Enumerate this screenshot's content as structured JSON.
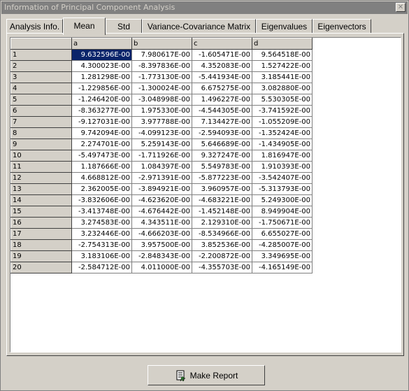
{
  "window": {
    "title": "Information of Principal Component Analysis",
    "close_glyph": "✕"
  },
  "tabs": [
    {
      "label": "Analysis Info.",
      "active": false
    },
    {
      "label": "Mean",
      "active": true
    },
    {
      "label": "Std",
      "active": false
    },
    {
      "label": "Variance-Covariance Matrix",
      "active": false
    },
    {
      "label": "Eigenvalues",
      "active": false
    },
    {
      "label": "Eigenvectors",
      "active": false
    }
  ],
  "grid": {
    "columns": [
      "a",
      "b",
      "c",
      "d"
    ],
    "rows": [
      {
        "label": "1",
        "values": [
          "9.632596E-00",
          "7.980617E-00",
          "-1.605471E-00",
          "9.564518E-00"
        ]
      },
      {
        "label": "2",
        "values": [
          "4.300023E-00",
          "-8.397836E-00",
          "4.352083E-00",
          "1.527422E-00"
        ]
      },
      {
        "label": "3",
        "values": [
          "1.281298E-00",
          "-1.773130E-00",
          "-5.441934E-00",
          "3.185441E-00"
        ]
      },
      {
        "label": "4",
        "values": [
          "-1.229856E-00",
          "-1.300024E-00",
          "6.675275E-00",
          "3.082880E-00"
        ]
      },
      {
        "label": "5",
        "values": [
          "-1.246420E-00",
          "-3.048998E-00",
          "1.496227E-00",
          "5.530305E-00"
        ]
      },
      {
        "label": "6",
        "values": [
          "-8.363277E-00",
          "1.975330E-00",
          "-4.544305E-00",
          "-3.741592E-00"
        ]
      },
      {
        "label": "7",
        "values": [
          "-9.127031E-00",
          "3.977788E-00",
          "7.134427E-00",
          "-1.055209E-00"
        ]
      },
      {
        "label": "8",
        "values": [
          "9.742094E-00",
          "-4.099123E-00",
          "-2.594093E-00",
          "-1.352424E-00"
        ]
      },
      {
        "label": "9",
        "values": [
          "2.274701E-00",
          "5.259143E-00",
          "5.646689E-00",
          "-1.434905E-00"
        ]
      },
      {
        "label": "10",
        "values": [
          "-5.497473E-00",
          "-1.711926E-00",
          "9.327247E-00",
          "1.816947E-00"
        ]
      },
      {
        "label": "11",
        "values": [
          "1.187666E-00",
          "1.084397E-00",
          "5.549783E-00",
          "1.910393E-00"
        ]
      },
      {
        "label": "12",
        "values": [
          "4.668812E-00",
          "-2.971391E-00",
          "-5.877223E-00",
          "-3.542407E-00"
        ]
      },
      {
        "label": "13",
        "values": [
          "2.362005E-00",
          "-3.894921E-00",
          "3.960957E-00",
          "-5.313793E-00"
        ]
      },
      {
        "label": "14",
        "values": [
          "-3.832606E-00",
          "-4.623620E-00",
          "-4.683221E-00",
          "5.249300E-00"
        ]
      },
      {
        "label": "15",
        "values": [
          "-3.413748E-00",
          "-4.676442E-00",
          "-1.452148E-00",
          "8.949904E-00"
        ]
      },
      {
        "label": "16",
        "values": [
          "3.274583E-00",
          "4.343511E-00",
          "2.129310E-00",
          "-1.750671E-00"
        ]
      },
      {
        "label": "17",
        "values": [
          "3.232446E-00",
          "-4.666203E-00",
          "-8.534966E-00",
          "6.655027E-00"
        ]
      },
      {
        "label": "18",
        "values": [
          "-2.754313E-00",
          "3.957500E-00",
          "3.852536E-00",
          "-4.285007E-00"
        ]
      },
      {
        "label": "19",
        "values": [
          "3.183106E-00",
          "-2.848343E-00",
          "-2.200872E-00",
          "3.349695E-00"
        ]
      },
      {
        "label": "20",
        "values": [
          "-2.584712E-00",
          "4.011000E-00",
          "-4.355703E-00",
          "-4.165149E-00"
        ]
      }
    ],
    "selected_cell": {
      "row": 0,
      "col": 0
    }
  },
  "footer": {
    "make_report_label": "Make Report"
  },
  "colors": {
    "selection": "#0a246a",
    "face": "#d4d0c8",
    "title_bar": "#808080"
  }
}
